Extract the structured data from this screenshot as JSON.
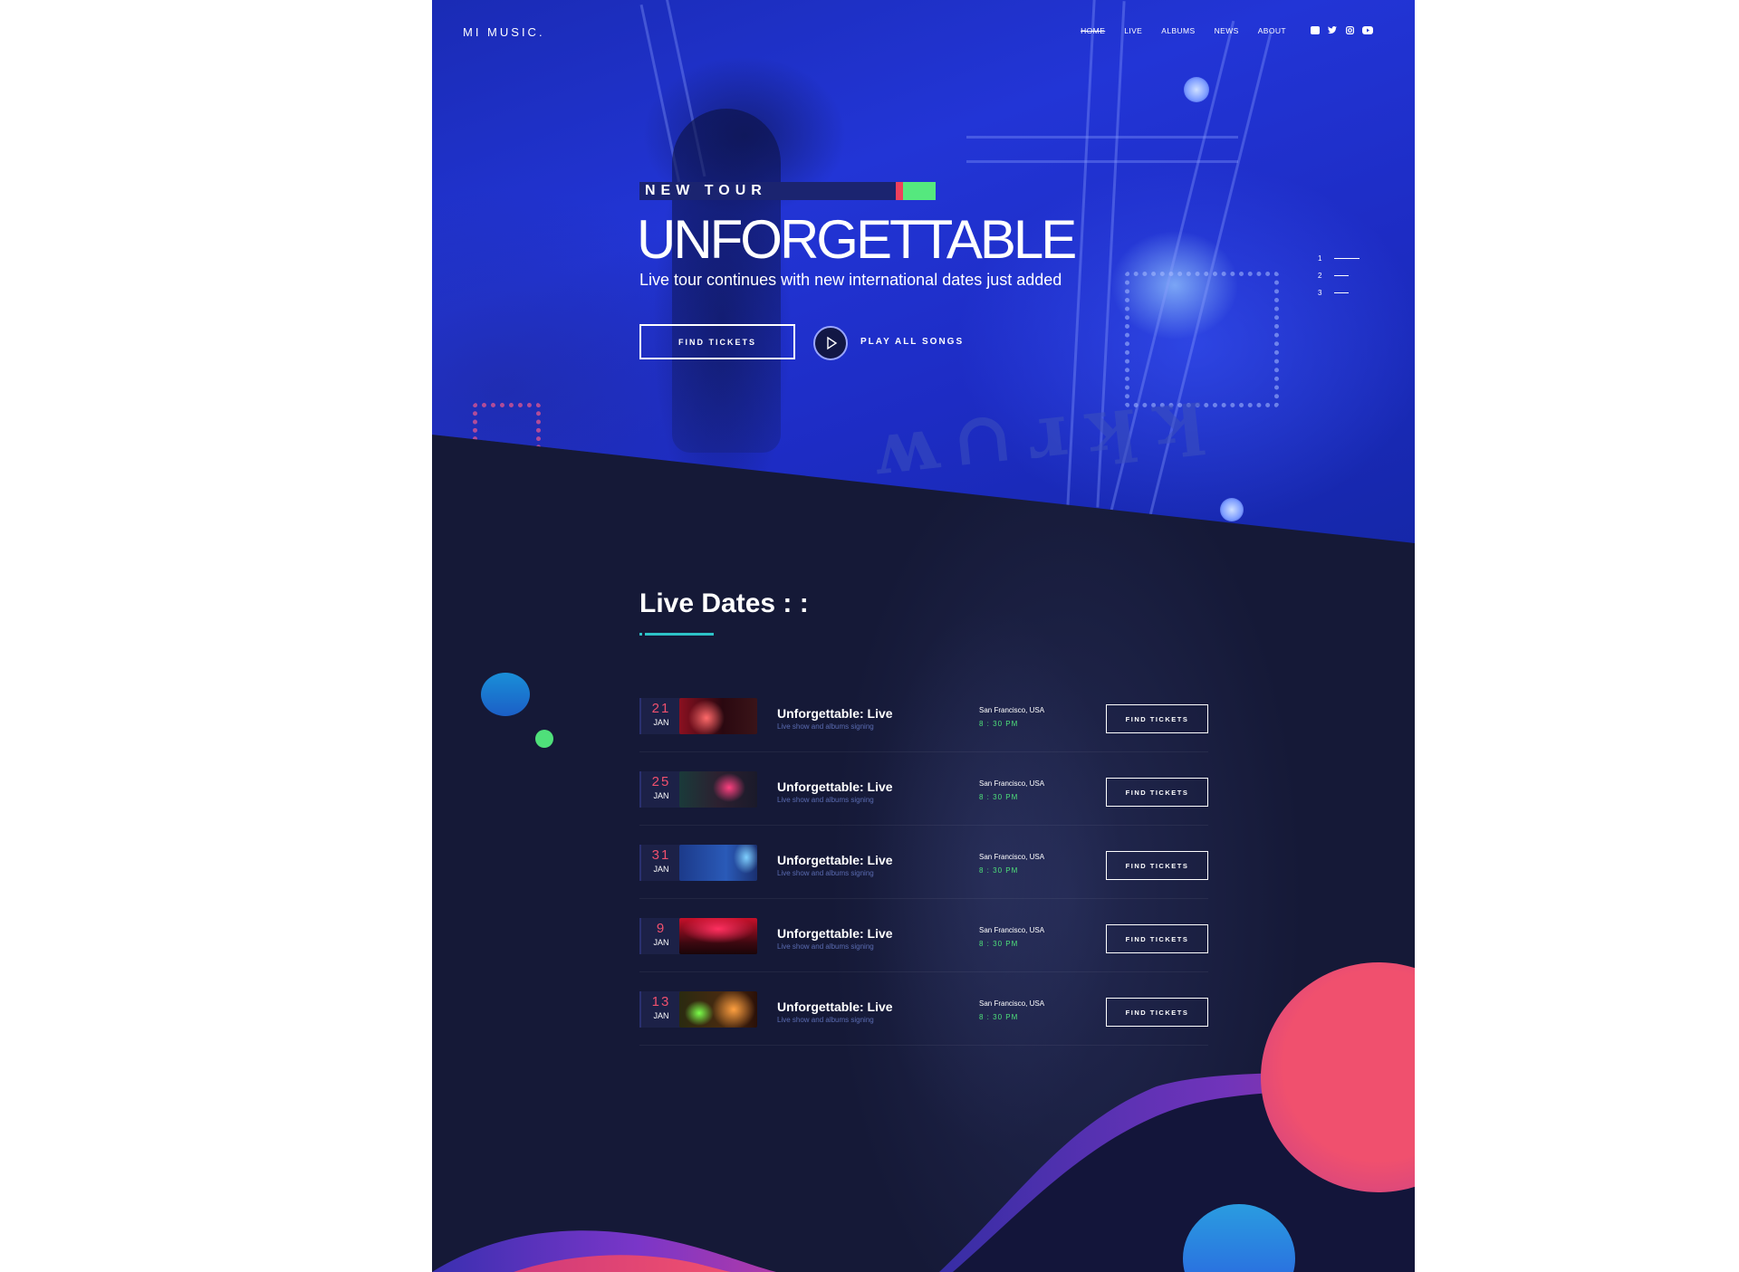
{
  "header": {
    "logo": "MI MUSIC.",
    "nav": [
      "HOME",
      "LIVE",
      "ALBUMS",
      "NEWS",
      "ABOUT"
    ],
    "social_icons": [
      "facebook-icon",
      "twitter-icon",
      "instagram-icon",
      "youtube-icon"
    ]
  },
  "hero": {
    "tag": "NEW TOUR",
    "title": "UNFORGETTABLE",
    "subtitle": "Live tour continues with new international dates just added",
    "find_tickets": "FIND TICKETS",
    "play_all": "PLAY ALL SONGS",
    "slides": [
      "1",
      "2",
      "3"
    ],
    "colors": {
      "tag_red": "#f0405c",
      "tag_green": "#55e87e",
      "hero_blue": "#2235d6"
    }
  },
  "live_dates": {
    "title": "Live Dates : :",
    "events": [
      {
        "day": "21",
        "month": "JAN",
        "title": "Unforgettable: Live",
        "subtitle": "Live show and albums signing",
        "location": "San Francisco, USA",
        "time": "8 : 30 PM",
        "button": "FIND TICKETS"
      },
      {
        "day": "25",
        "month": "JAN",
        "title": "Unforgettable: Live",
        "subtitle": "Live show and albums signing",
        "location": "San Francisco, USA",
        "time": "8 : 30 PM",
        "button": "FIND TICKETS"
      },
      {
        "day": "31",
        "month": "JAN",
        "title": "Unforgettable: Live",
        "subtitle": "Live show and albums signing",
        "location": "San Francisco, USA",
        "time": "8 : 30 PM",
        "button": "FIND TICKETS"
      },
      {
        "day": "9",
        "month": "JAN",
        "title": "Unforgettable: Live",
        "subtitle": "Live show and albums signing",
        "location": "San Francisco, USA",
        "time": "8 : 30 PM",
        "button": "FIND TICKETS"
      },
      {
        "day": "13",
        "month": "JAN",
        "title": "Unforgettable: Live",
        "subtitle": "Live show and albums signing",
        "location": "San Francisco, USA",
        "time": "8 : 30 PM",
        "button": "FIND TICKETS"
      }
    ],
    "colors": {
      "day": "#f0506e",
      "time": "#4fe07a",
      "accent_line": "#2dc3c7"
    }
  }
}
